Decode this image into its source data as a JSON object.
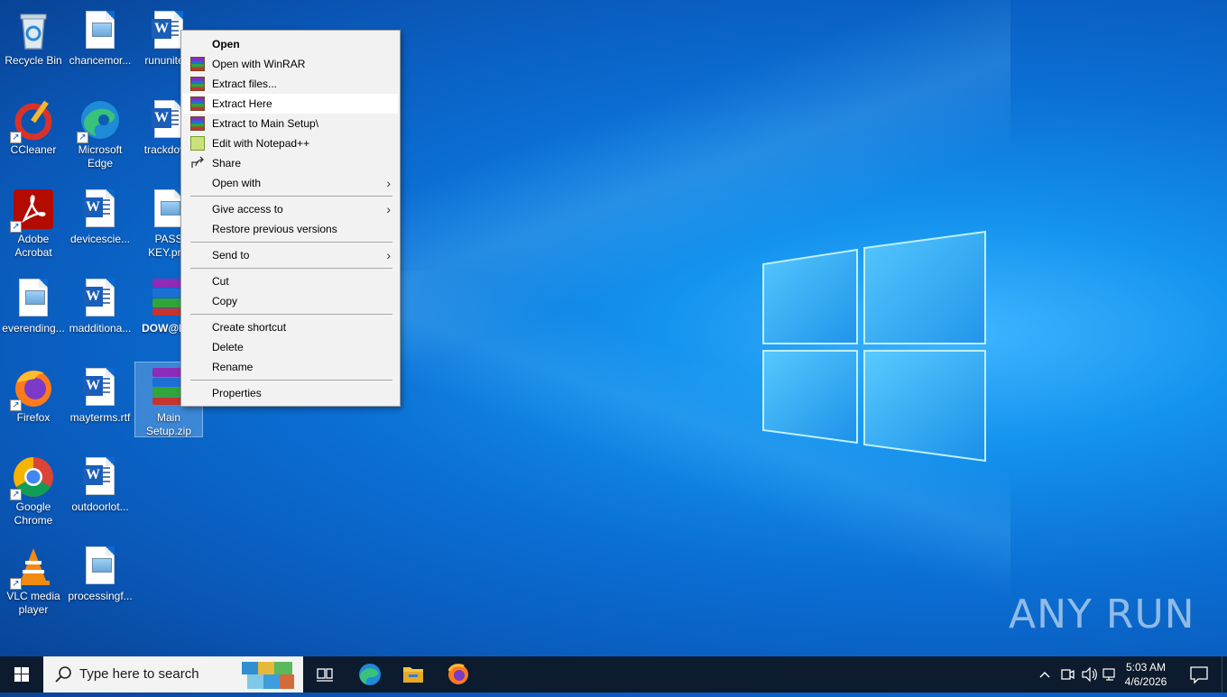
{
  "desktop": {
    "icons": [
      {
        "label": "Recycle Bin"
      },
      {
        "label": "chancemor..."
      },
      {
        "label": "rununite..."
      },
      {
        "label": "CCleaner"
      },
      {
        "label": "Microsoft Edge"
      },
      {
        "label": "trackdov..."
      },
      {
        "label": "Adobe Acrobat"
      },
      {
        "label": "devicescie..."
      },
      {
        "label": "PASS KEY.pr..."
      },
      {
        "label": "everending..."
      },
      {
        "label": "madditiona..."
      },
      {
        "label": "DOW@N..."
      },
      {
        "label": "Firefox"
      },
      {
        "label": "mayterms.rtf"
      },
      {
        "label": "Main Setup.zip"
      },
      {
        "label": "Google Chrome"
      },
      {
        "label": "outdoorlot..."
      },
      {
        "label": "VLC media player"
      },
      {
        "label": "processingf..."
      }
    ]
  },
  "context_menu": {
    "items": [
      {
        "label": "Open"
      },
      {
        "label": "Open with WinRAR"
      },
      {
        "label": "Extract files..."
      },
      {
        "label": "Extract Here"
      },
      {
        "label": "Extract to Main Setup\\"
      },
      {
        "label": "Edit with Notepad++"
      },
      {
        "label": "Share"
      },
      {
        "label": "Open with"
      },
      {
        "label": "Give access to"
      },
      {
        "label": "Restore previous versions"
      },
      {
        "label": "Send to"
      },
      {
        "label": "Cut"
      },
      {
        "label": "Copy"
      },
      {
        "label": "Create shortcut"
      },
      {
        "label": "Delete"
      },
      {
        "label": "Rename"
      },
      {
        "label": "Properties"
      }
    ],
    "highlighted": "Extract Here"
  },
  "watermark": "ANY RUN",
  "taskbar": {
    "search_placeholder": "Type here to search",
    "clock_time": "5:03 AM",
    "clock_date": "4/6/2026"
  }
}
